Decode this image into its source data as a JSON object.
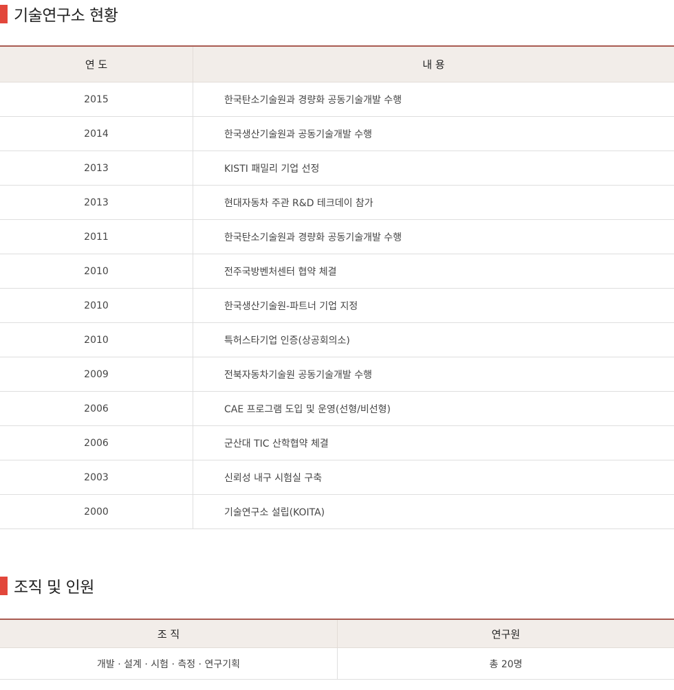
{
  "sections": {
    "history_title": "기술연구소 현황",
    "org_title": "조직 및 인원"
  },
  "colors": {
    "accent": "#e2473b",
    "header_bg": "#f2ede9",
    "header_border": "#a85a50"
  },
  "history": {
    "headers": {
      "year": "연 도",
      "content": "내 용"
    },
    "rows": [
      {
        "year": "2015",
        "content": "한국탄소기술원과 경량화 공동기술개발 수행"
      },
      {
        "year": "2014",
        "content": "한국생산기술원과 공동기술개발 수행"
      },
      {
        "year": "2013",
        "content": "KISTI 패밀리 기업 선정"
      },
      {
        "year": "2013",
        "content": "현대자동차 주관 R&D 테크데이 참가"
      },
      {
        "year": "2011",
        "content": "한국탄소기술원과 경량화 공동기술개발 수행"
      },
      {
        "year": "2010",
        "content": "전주국방벤처센터 협약 체결"
      },
      {
        "year": "2010",
        "content": "한국생산기술원-파트너 기업 지정"
      },
      {
        "year": "2010",
        "content": "특허스타기업 인증(상공회의소)"
      },
      {
        "year": "2009",
        "content": "전북자동차기술원 공동기술개발 수행"
      },
      {
        "year": "2006",
        "content": "CAE 프로그램 도입 및 운영(선형/비선형)"
      },
      {
        "year": "2006",
        "content": "군산대 TIC 산학협약 체결"
      },
      {
        "year": "2003",
        "content": "신뢰성 내구 시험실 구축"
      },
      {
        "year": "2000",
        "content": "기술연구소 설립(KOITA)"
      }
    ]
  },
  "organization": {
    "headers": {
      "org": "조 직",
      "researchers": "연구원"
    },
    "rows": [
      {
        "org": "개발 · 설계 · 시험 · 측정 · 연구기획",
        "researchers": "총 20명"
      }
    ]
  }
}
